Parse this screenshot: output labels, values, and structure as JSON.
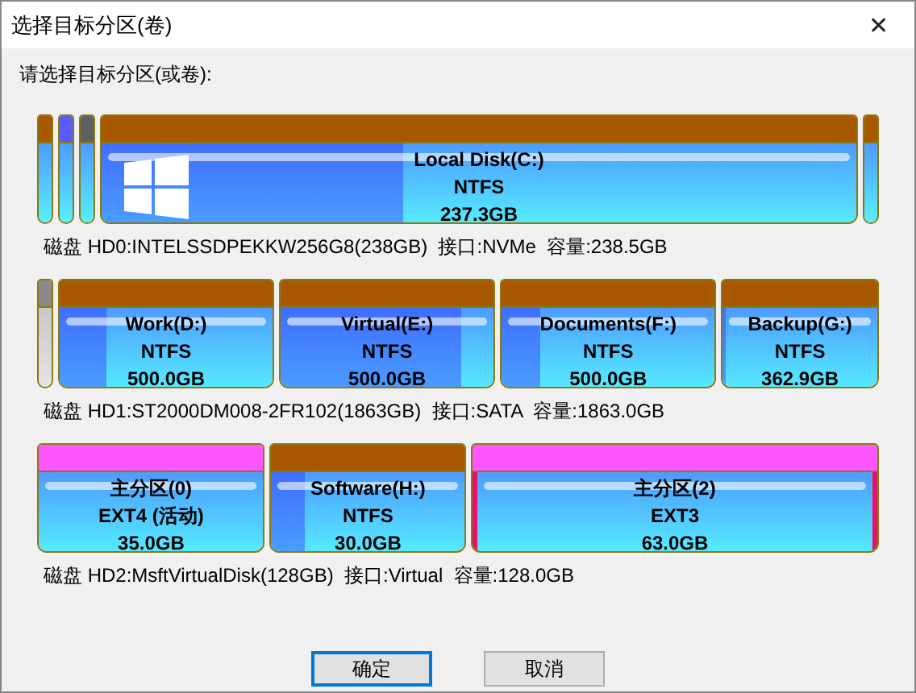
{
  "window": {
    "title": "选择目标分区(卷)",
    "close": "✕"
  },
  "prompt": "请选择目标分区(或卷):",
  "disks": [
    {
      "partitions": [
        {
          "kind": "partition",
          "color": "#a85800",
          "selected": false
        },
        {
          "kind": "partition",
          "color": "#5a5aff",
          "selected": false
        },
        {
          "kind": "partition",
          "color": "#606060",
          "selected": false
        },
        {
          "kind": "partition",
          "color": "#a85800",
          "selected": false,
          "os_logo": true,
          "label": "Local Disk(C:)",
          "fs": "NTFS",
          "size": "237.3GB",
          "level": 0.4
        },
        {
          "kind": "partition",
          "color": "#a85800",
          "selected": false
        }
      ],
      "info": "磁盘 HD0:INTELSSDPEKKW256G8(238GB)  接口:NVMe  容量:238.5GB"
    },
    {
      "partitions": [
        {
          "kind": "unallocated",
          "color": "#8a8a8a",
          "selected": false
        },
        {
          "kind": "partition",
          "color": "#a85800",
          "selected": false,
          "label": "Work(D:)",
          "fs": "NTFS",
          "size": "500.0GB",
          "level": 0.22
        },
        {
          "kind": "partition",
          "color": "#a85800",
          "selected": false,
          "label": "Virtual(E:)",
          "fs": "NTFS",
          "size": "500.0GB",
          "level": 0.85
        },
        {
          "kind": "partition",
          "color": "#a85800",
          "selected": false,
          "label": "Documents(F:)",
          "fs": "NTFS",
          "size": "500.0GB",
          "level": 0.18
        },
        {
          "kind": "partition",
          "color": "#a85800",
          "selected": false,
          "label": "Backup(G:)",
          "fs": "NTFS",
          "size": "362.9GB",
          "level": 0.02
        }
      ],
      "info": "磁盘 HD1:ST2000DM008-2FR102(1863GB)  接口:SATA  容量:1863.0GB"
    },
    {
      "partitions": [
        {
          "kind": "partition",
          "color": "#ff55ff",
          "selected": false,
          "label": "主分区(0)",
          "fs": "EXT4 (活动)",
          "size": "35.0GB"
        },
        {
          "kind": "partition",
          "color": "#a85800",
          "selected": false,
          "label": "Software(H:)",
          "fs": "NTFS",
          "size": "30.0GB",
          "level": 0.17
        },
        {
          "kind": "partition",
          "color": "#ff55ff",
          "selected": true,
          "label": "主分区(2)",
          "fs": "EXT3",
          "size": "63.0GB"
        }
      ],
      "info": "磁盘 HD2:MsftVirtualDisk(128GB)  接口:Virtual  容量:128.0GB"
    }
  ],
  "buttons": [
    {
      "label": "确定",
      "focused": true
    },
    {
      "label": "取消",
      "focused": false
    }
  ]
}
